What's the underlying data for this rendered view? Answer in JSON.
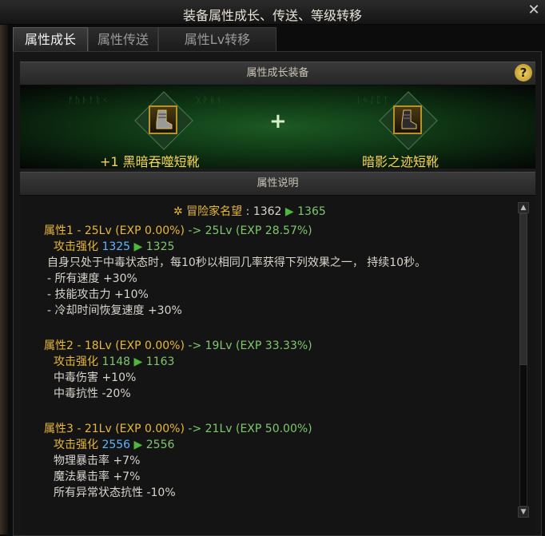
{
  "window": {
    "title": "装备属性成长、传送、等级转移",
    "close_glyph": "✕"
  },
  "tabs": [
    {
      "label": "属性成长",
      "active": true
    },
    {
      "label": "属性传送",
      "active": false
    },
    {
      "label": "属性Lv转移",
      "active": false
    }
  ],
  "equip_section": {
    "header": "属性成长装备",
    "help_glyph": "?",
    "plus_glyph": "+",
    "left_item": {
      "name": "+1 黑暗吞噬短靴",
      "icon": "boot-icon"
    },
    "right_item": {
      "name": "暗影之迹短靴",
      "icon": "boot-icon"
    }
  },
  "desc_section": {
    "header": "属性说明",
    "reputation": {
      "label": "冒险家名望",
      "from": "1362",
      "to": "1365"
    },
    "attributes": [
      {
        "title": "属性1 - 25Lv (EXP 0.00%)",
        "arrow_text": "->",
        "result": "25Lv (EXP 28.57%)",
        "atk_label": "攻击强化",
        "atk_from": "1325",
        "atk_to": "1325",
        "lines": [
          "自身只处于中毒状态时，每10秒以相同几率获得下列效果之一， 持续10秒。",
          "- 所有速度 +30%",
          "- 技能攻击力 +10%",
          "- 冷却时间恢复速度 +30%"
        ]
      },
      {
        "title": "属性2 - 18Lv (EXP 0.00%)",
        "arrow_text": "->",
        "result": "19Lv (EXP 33.33%)",
        "atk_label": "攻击强化",
        "atk_from": "1148",
        "atk_to": "1163",
        "lines": [
          "中毒伤害 +10%",
          "中毒抗性 -20%"
        ]
      },
      {
        "title": "属性3 - 21Lv (EXP 0.00%)",
        "arrow_text": "->",
        "result": "21Lv (EXP 50.00%)",
        "atk_label": "攻击强化",
        "atk_from": "2556",
        "atk_to": "2556",
        "lines": [
          "物理暴击率 +7%",
          "魔法暴击率 +7%",
          "所有异常状态抗性 -10%"
        ]
      }
    ]
  },
  "colors": {
    "gold": "#e8b838",
    "green": "#7ec86c",
    "blue": "#5fb6ff",
    "yellow": "#f7d358"
  }
}
